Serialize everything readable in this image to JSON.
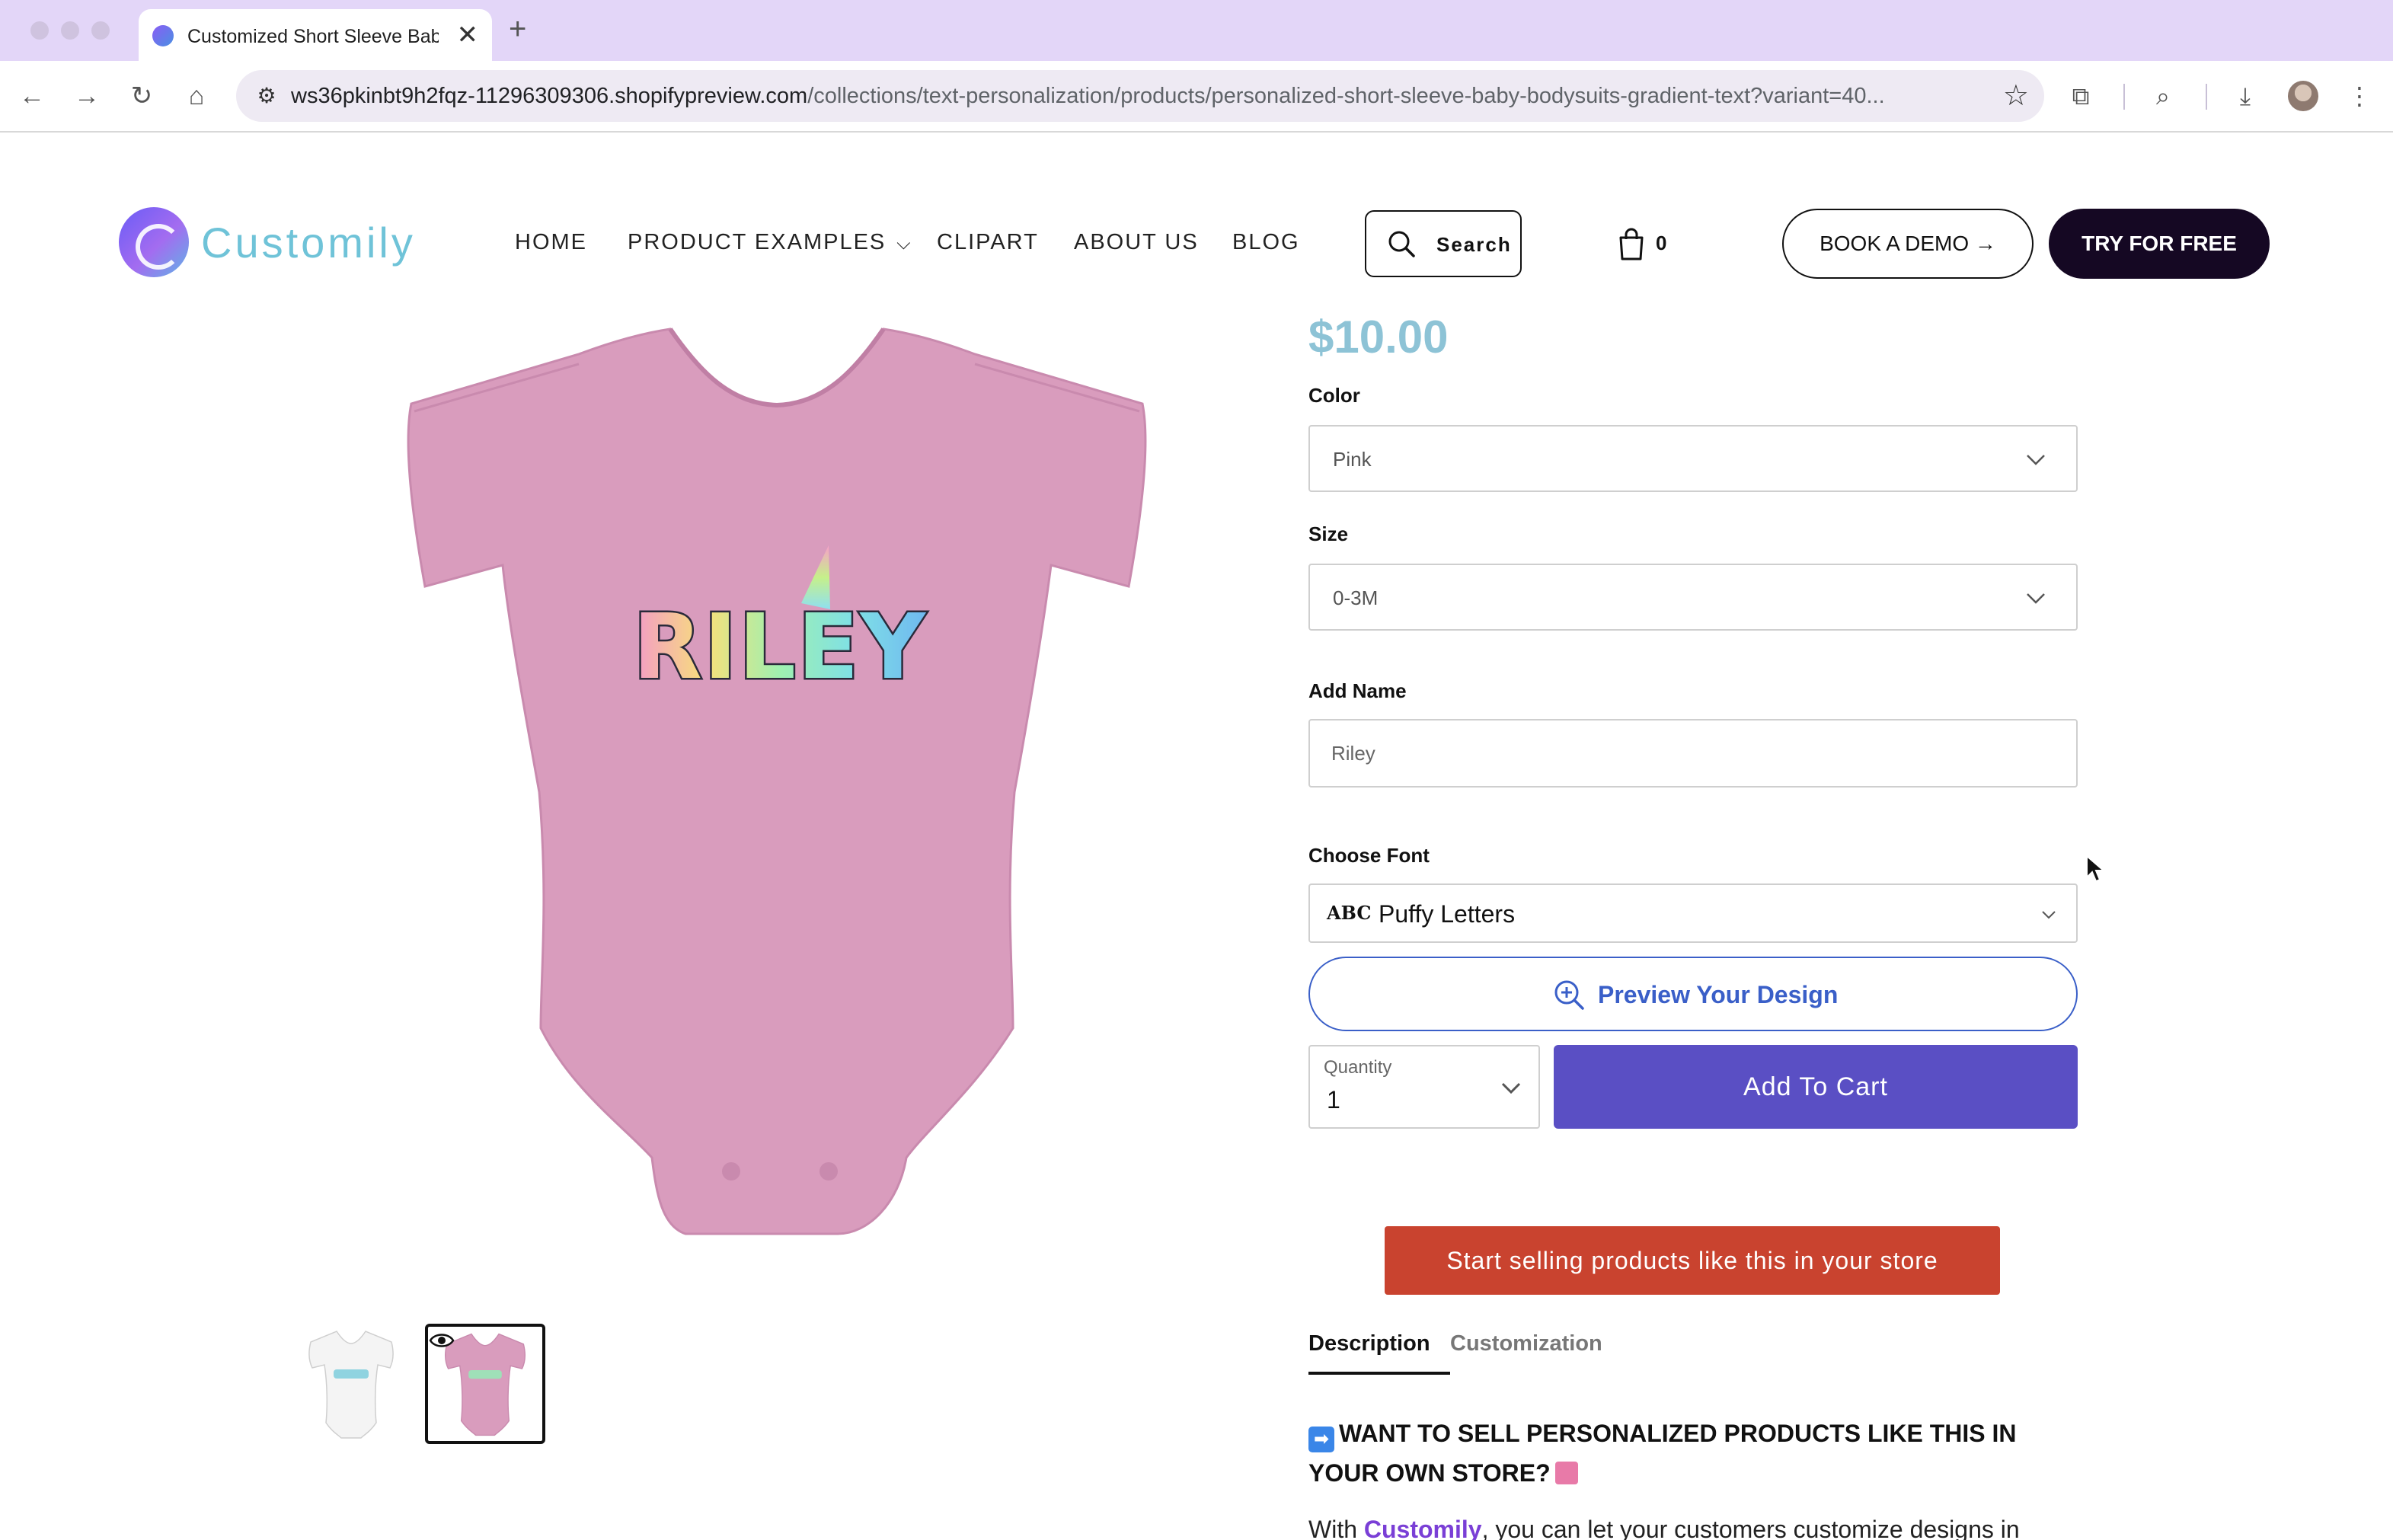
{
  "browser": {
    "tab_title": "Customized Short Sleeve Bab",
    "url_host": "ws36pkinbt9h2fqz-11296309306.shopifypreview.com",
    "url_path": "/collections/text-personalization/products/personalized-short-sleeve-baby-bodysuits-gradient-text?variant=40...",
    "new_tab_glyph": "+",
    "close_glyph": "✕"
  },
  "site": {
    "logo_text": "Customily",
    "nav": {
      "home": "HOME",
      "product_examples": "PRODUCT EXAMPLES",
      "clipart": "CLIPART",
      "about": "ABOUT US",
      "blog": "BLOG"
    },
    "search_label": "Search",
    "cart_count": "0",
    "book_demo": "BOOK A DEMO →",
    "try_free": "TRY FOR FREE"
  },
  "product": {
    "price": "$10.00",
    "design_text": "RILEY",
    "color_label": "Color",
    "color_value": "Pink",
    "size_label": "Size",
    "size_value": "0-3M",
    "name_label": "Add Name",
    "name_value": "Riley",
    "font_label": "Choose Font",
    "font_icon_text": "ABC",
    "font_value": "Puffy Letters",
    "preview_label": "Preview Your Design",
    "quantity_label": "Quantity",
    "quantity_value": "1",
    "add_to_cart": "Add To Cart",
    "sell_cta": "Start selling products like this in your store",
    "tabs": [
      "Description",
      "Customization"
    ],
    "desc_heading": "WANT TO SELL PERSONALIZED PRODUCTS LIKE THIS IN YOUR OWN STORE?",
    "desc_body_prefix": "With ",
    "desc_body_brand": "Customily",
    "desc_body_suffix": ", you can let your customers customize designs in"
  },
  "colors": {
    "brand_teal": "#8dc3d6",
    "cart_button": "#5a4fc4",
    "sell_button": "#c9432f",
    "preview_blue": "#3a5fc8",
    "onesie_pink": "#d99cbd"
  },
  "icons": [
    "search-icon",
    "cart-icon",
    "chevron-down-icon",
    "zoom-in-icon",
    "eye-icon",
    "star-icon",
    "extensions-icon",
    "download-icon",
    "menu-icon"
  ]
}
